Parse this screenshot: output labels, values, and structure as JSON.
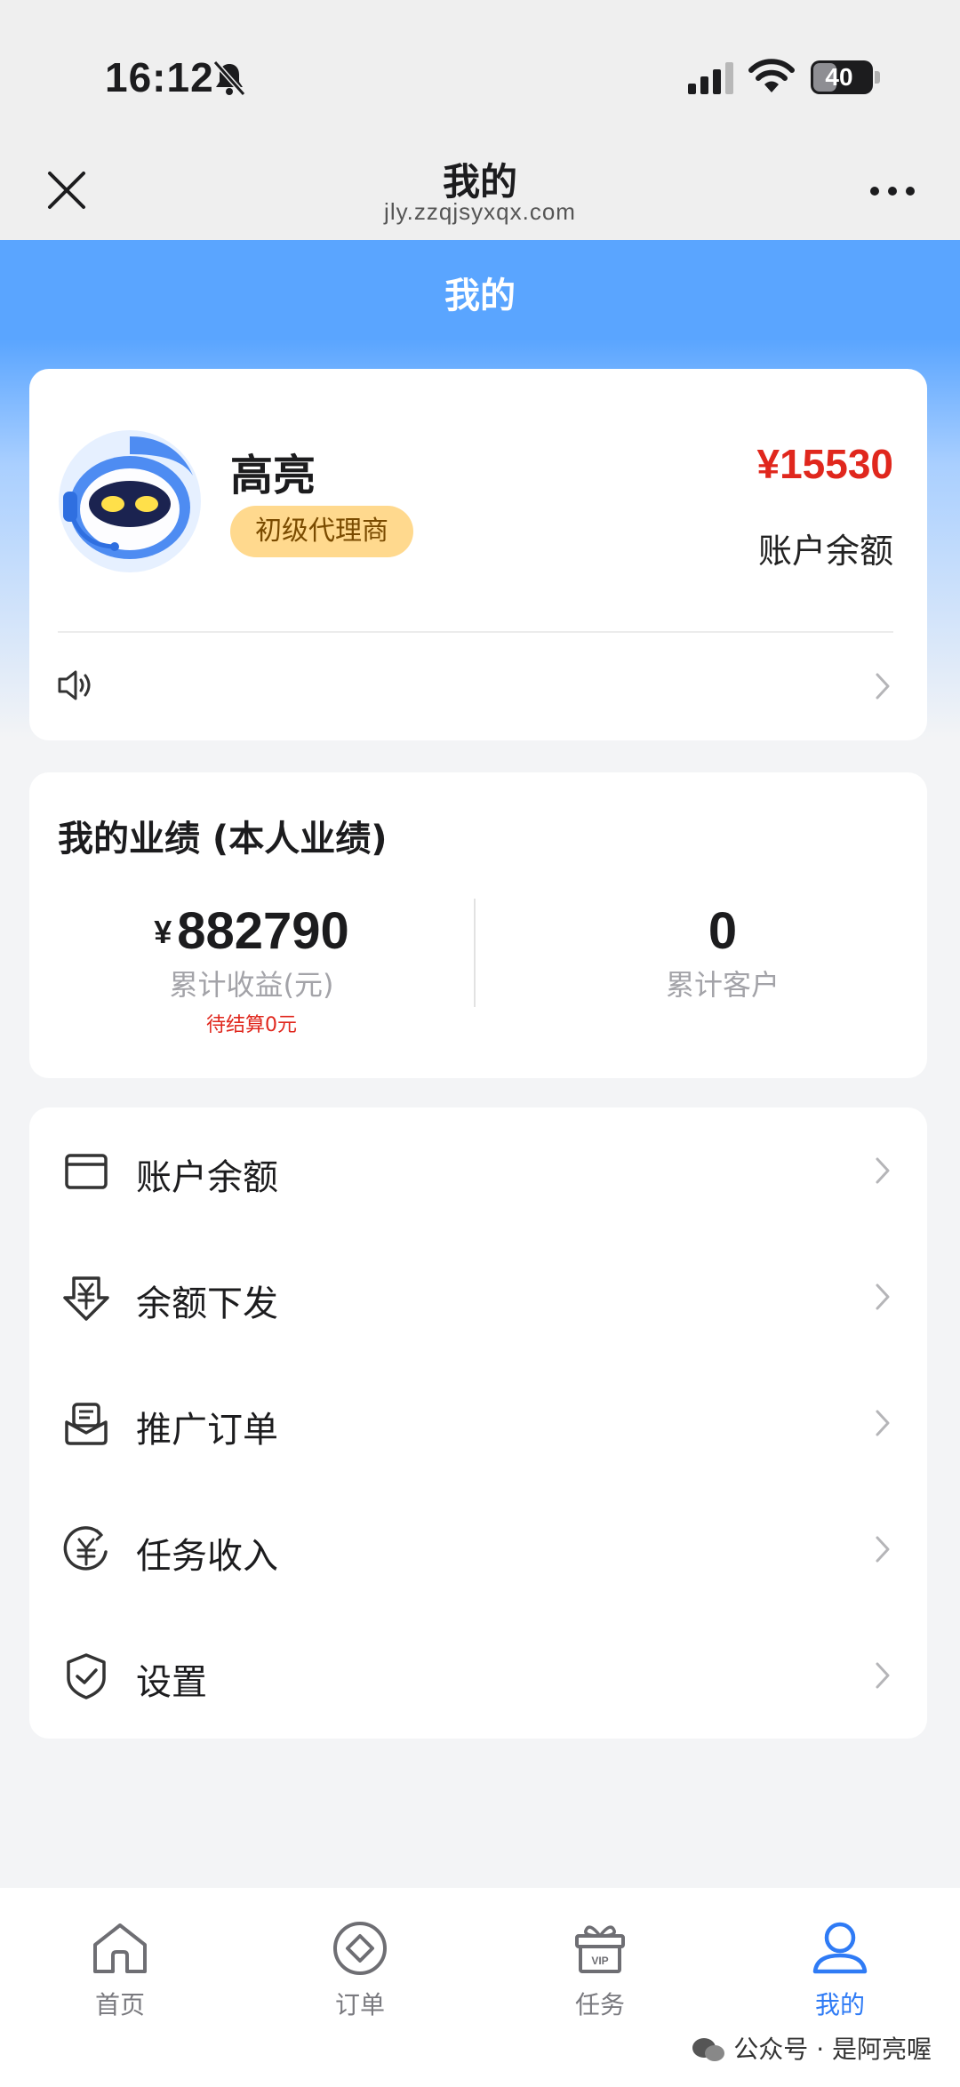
{
  "status_bar": {
    "time": "16:12",
    "battery": "40"
  },
  "nav": {
    "title": "我的",
    "url": "jly.zzqjsyxqx.com"
  },
  "page": {
    "heading": "我的"
  },
  "profile": {
    "name": "高亮",
    "level": "初级代理商",
    "balance": "¥15530",
    "balance_label": "账户余额"
  },
  "performance": {
    "title": "我的业绩 (本人业绩)",
    "earnings": {
      "currency": "¥",
      "value": "882790",
      "label": "累计收益(元)",
      "pending": "待结算0元"
    },
    "customers": {
      "value": "0",
      "label": "累计客户"
    }
  },
  "menu": [
    {
      "label": "账户余额",
      "icon": "wallet-icon"
    },
    {
      "label": "余额下发",
      "icon": "yuan-download-icon"
    },
    {
      "label": "推广订单",
      "icon": "order-inbox-icon"
    },
    {
      "label": "任务收入",
      "icon": "yuan-circle-icon"
    },
    {
      "label": "设置",
      "icon": "shield-check-icon"
    }
  ],
  "tabs": [
    {
      "label": "首页",
      "icon": "home-icon",
      "active": false
    },
    {
      "label": "订单",
      "icon": "order-icon",
      "active": false
    },
    {
      "label": "任务",
      "icon": "vip-gift-icon",
      "active": false
    },
    {
      "label": "我的",
      "icon": "user-icon",
      "active": true
    }
  ],
  "watermark": "公众号 · 是阿亮喔",
  "colors": {
    "accent": "#2f7bf5",
    "header_blue": "#5aa5ff",
    "price_red": "#e0271d",
    "badge": "#ffd98e"
  }
}
